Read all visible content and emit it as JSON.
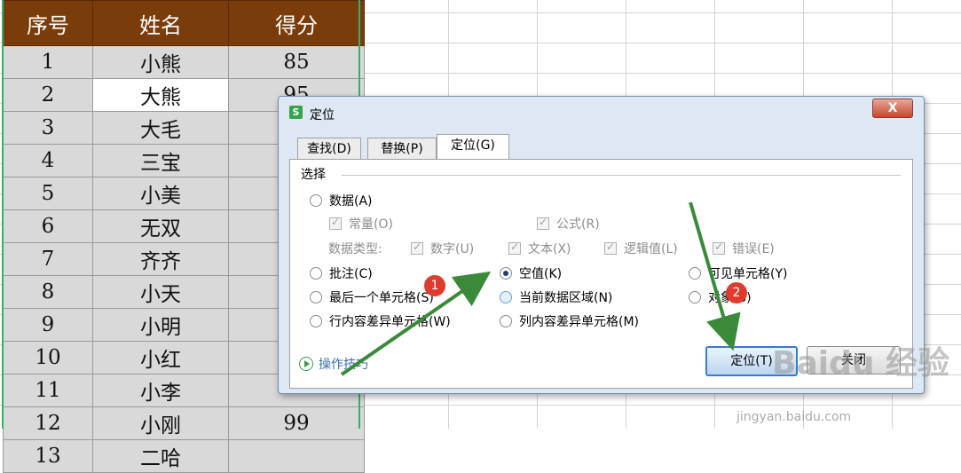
{
  "sheet": {
    "headers": [
      "序号",
      "姓名",
      "得分"
    ],
    "rows": [
      [
        "1",
        "小熊",
        "85"
      ],
      [
        "2",
        "大熊",
        "95"
      ],
      [
        "3",
        "大毛",
        ""
      ],
      [
        "4",
        "三宝",
        ""
      ],
      [
        "5",
        "小美",
        ""
      ],
      [
        "6",
        "无双",
        ""
      ],
      [
        "7",
        "齐齐",
        ""
      ],
      [
        "8",
        "小天",
        ""
      ],
      [
        "9",
        "小明",
        ""
      ],
      [
        "10",
        "小红",
        ""
      ],
      [
        "11",
        "小李",
        ""
      ],
      [
        "12",
        "小刚",
        "99"
      ],
      [
        "13",
        "二哈",
        ""
      ]
    ]
  },
  "dialog": {
    "title": "定位",
    "logo": "S",
    "close_label": "X",
    "tabs": [
      "查找(D)",
      "替换(P)",
      "定位(G)"
    ],
    "section_title": "选择",
    "options": {
      "data": "数据(A)",
      "constant": "常量(O)",
      "formula": "公式(R)",
      "data_type_label": "数据类型:",
      "number": "数字(U)",
      "text": "文本(X)",
      "logical": "逻辑值(L)",
      "error": "错误(E)",
      "comment": "批注(C)",
      "blank": "空值(K)",
      "visible_cells": "可见单元格(Y)",
      "last_cell": "最后一个单元格(S)",
      "current_region": "当前数据区域(N)",
      "objects": "对象(B)",
      "row_diff": "行内容差异单元格(W)",
      "col_diff": "列内容差异单元格(M)"
    },
    "selected_option": "空值(K)",
    "help_link": "操作技巧",
    "ok_button": "定位(T)",
    "close_button": "关闭"
  },
  "annotations": {
    "badge1": "1",
    "badge2": "2",
    "arrow_color": "#3a8a3a"
  },
  "watermark": {
    "main": "Baidu 经验",
    "url": "jingyan.baidu.com"
  }
}
